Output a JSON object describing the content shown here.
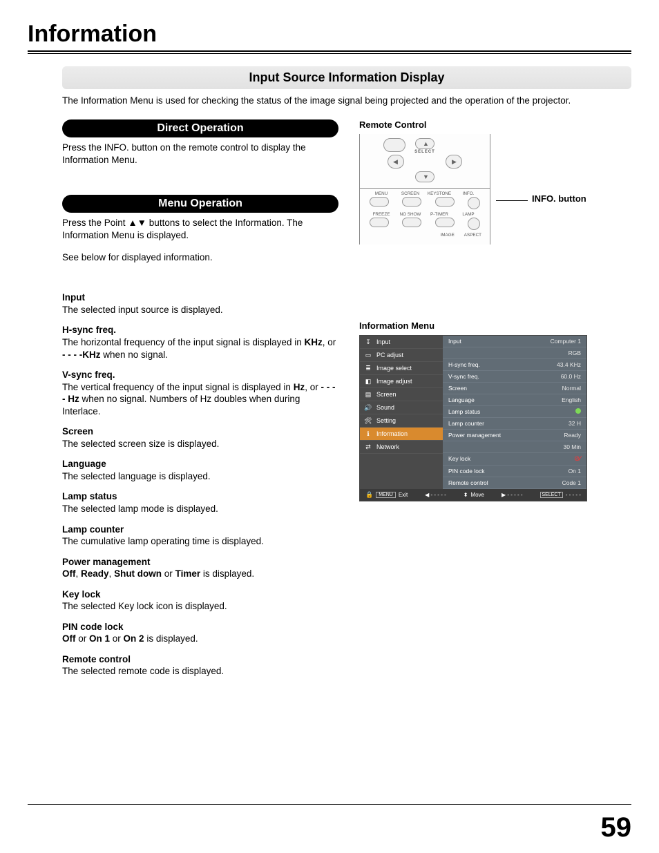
{
  "page": {
    "title": "Information",
    "number": "59"
  },
  "banner": "Input Source Information Display",
  "intro": "The Information Menu is used for checking the status of the image signal being projected and the operation of the projector.",
  "sections": {
    "direct": {
      "heading": "Direct Operation",
      "body": "Press the INFO. button on the remote control to display the Information Menu."
    },
    "menu": {
      "heading": "Menu Operation",
      "body1_a": "Press the Point ",
      "body1_b": " buttons to select the Information. The Information Menu is displayed.",
      "body2": "See below for displayed information."
    }
  },
  "definitions": [
    {
      "term": "Input",
      "desc": "The selected input source is displayed."
    },
    {
      "term": "H-sync freq.",
      "desc": "The horizontal frequency of the input signal is displayed in <b>KHz</b>, or <b>- - - -KHz</b> when no signal."
    },
    {
      "term": "V-sync freq.",
      "desc": "The vertical frequency of the input signal is displayed in <b>Hz</b>, or <b>- - - - Hz</b>  when no signal. Numbers of Hz doubles when during Interlace."
    },
    {
      "term": "Screen",
      "desc": "The selected screen size is displayed."
    },
    {
      "term": "Language",
      "desc": "The selected language is displayed."
    },
    {
      "term": "Lamp status",
      "desc": "The selected lamp mode is displayed."
    },
    {
      "term": "Lamp counter",
      "desc": "The cumulative lamp operating time is displayed."
    },
    {
      "term": "Power management",
      "desc": "<b>Off</b>, <b>Ready</b>, <b>Shut down</b> or <b>Timer</b> is displayed."
    },
    {
      "term": "Key lock",
      "desc": "The selected Key lock icon is displayed."
    },
    {
      "term": "PIN code lock",
      "desc": "<b>Off</b> or <b>On 1</b> or <b>On 2</b> is displayed."
    },
    {
      "term": "Remote control",
      "desc": "The selected remote code  is displayed."
    }
  ],
  "right": {
    "remote_label": "Remote Control",
    "info_button_label": "INFO. button",
    "remote_labels": {
      "select": "SELECT",
      "row1": [
        "MENU",
        "SCREEN",
        "KEYSTONE",
        "INFO."
      ],
      "row2": [
        "FREEZE",
        "NO SHOW",
        "P-TIMER",
        "LAMP"
      ],
      "row3": [
        "",
        "",
        "IMAGE",
        "ASPECT"
      ]
    },
    "info_menu_label": "Information Menu",
    "menu_left": [
      {
        "icon": "↧",
        "label": "Input"
      },
      {
        "icon": "▭",
        "label": "PC adjust"
      },
      {
        "icon": "≣",
        "label": "Image select"
      },
      {
        "icon": "◧",
        "label": "Image adjust"
      },
      {
        "icon": "▤",
        "label": "Screen"
      },
      {
        "icon": "🔊",
        "label": "Sound"
      },
      {
        "icon": "🛠",
        "label": "Setting"
      },
      {
        "icon": "ℹ",
        "label": "Information",
        "active": true
      },
      {
        "icon": "⇄",
        "label": "Network"
      }
    ],
    "menu_right": [
      {
        "k": "Input",
        "v": "Computer 1"
      },
      {
        "k": "",
        "v": "RGB"
      },
      {
        "k": "H-sync freq.",
        "v": "43.4 KHz"
      },
      {
        "k": "V-sync freq.",
        "v": "60.0 Hz"
      },
      {
        "k": "Screen",
        "v": "Normal"
      },
      {
        "k": "Language",
        "v": "English"
      },
      {
        "k": "Lamp status",
        "v": "__GREEN_DOT__"
      },
      {
        "k": "Lamp counter",
        "v": "32 H"
      },
      {
        "k": "Power management",
        "v": "Ready"
      },
      {
        "k": "",
        "v": "30 Min"
      },
      {
        "k": "Key lock",
        "v": "__KEYLOCK__"
      },
      {
        "k": "PIN code lock",
        "v": "On 1"
      },
      {
        "k": "Remote control",
        "v": "Code 1"
      }
    ],
    "menu_foot": {
      "exit": "Exit",
      "move": "Move",
      "select": "SELECT"
    }
  }
}
